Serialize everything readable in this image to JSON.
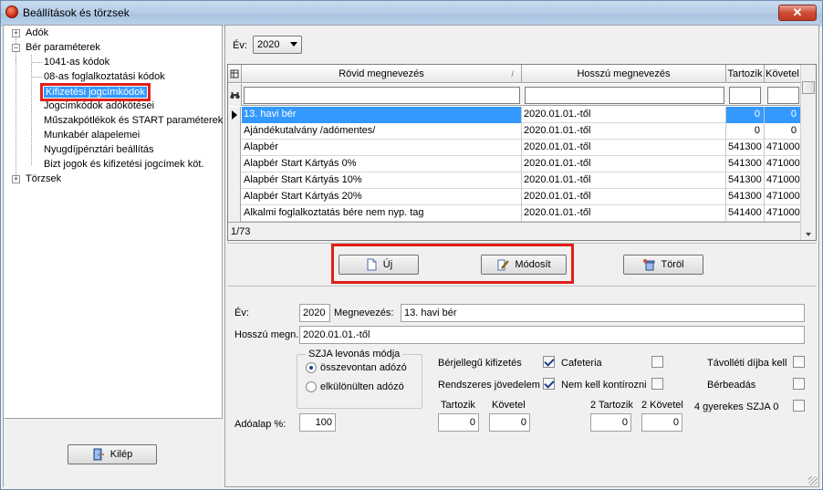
{
  "window": {
    "title": "Beállítások és törzsek",
    "close_label": "✕"
  },
  "tree": {
    "items": [
      {
        "label": "Adók",
        "level": 0,
        "expander": "+"
      },
      {
        "label": "Bér paraméterek",
        "level": 0,
        "expander": "−"
      },
      {
        "label": "1041-as kódok",
        "level": 1
      },
      {
        "label": "08-as foglalkoztatási kódok",
        "level": 1
      },
      {
        "label": "Kifizetési jogcímkódok",
        "level": 1,
        "selected": true
      },
      {
        "label": "Jogcímkódok adókötései",
        "level": 1
      },
      {
        "label": "Műszakpótlékok és START paraméterek",
        "level": 1
      },
      {
        "label": "Munkabér alapelemei",
        "level": 1
      },
      {
        "label": "Nyugdíjpénztári beállítás",
        "level": 1
      },
      {
        "label": "Bizt jogok és kifizetési jogcímek köt.",
        "level": 1
      },
      {
        "label": "Törzsek",
        "level": 0,
        "expander": "+"
      }
    ]
  },
  "exit_button": {
    "label": "Kilép"
  },
  "year_filter": {
    "label": "Év:",
    "value": "2020"
  },
  "grid": {
    "columns": [
      "Rövid megnevezés",
      "Hosszú megnevezés",
      "Tartozik",
      "Követel"
    ],
    "rows": [
      [
        "13. havi bér",
        "2020.01.01.-től",
        "0",
        "0"
      ],
      [
        "Ajándékutalvány /adómentes/",
        "2020.01.01.-től",
        "0",
        "0"
      ],
      [
        "Alapbér",
        "2020.01.01.-től",
        "541300",
        "471000"
      ],
      [
        "Alapbér Start Kártyás 0%",
        "2020.01.01.-től",
        "541300",
        "471000"
      ],
      [
        "Alapbér Start Kártyás 10%",
        "2020.01.01.-től",
        "541300",
        "471000"
      ],
      [
        "Alapbér Start Kártyás 20%",
        "2020.01.01.-től",
        "541300",
        "471000"
      ],
      [
        "Alkalmi foglalkoztatás bére nem nyp. tag",
        "2020.01.01.-től",
        "541400",
        "471000"
      ]
    ],
    "footer": "1/73"
  },
  "buttons": {
    "new_label": "Új",
    "modify_label": "Módosít",
    "delete_label": "Töröl"
  },
  "form": {
    "year_label": "Év:",
    "year_value": "2020",
    "name_label": "Megnevezés:",
    "name_value": "13. havi bér",
    "long_label": "Hosszú megn.:",
    "long_value": "2020.01.01.-től",
    "szja_group_label": "SZJA levonás módja",
    "radio_1": "összevontan adózó",
    "radio_2": "elkülönülten adózó",
    "berjellegu_label": "Bérjellegű kifizetés",
    "cafeteria_label": "Cafeteria",
    "tavolleti_label": "Távolléti díjba kell",
    "rendszeres_label": "Rendszeres jövedelem",
    "nemkell_label": "Nem kell kontírozni",
    "berbeadas_label": "Bérbeadás",
    "tartozik_label": "Tartozik",
    "tartozik_value": "0",
    "kovetel_label": "Követel",
    "kovetel_value": "0",
    "tartozik2_label": "2 Tartozik",
    "tartozik2_value": "0",
    "kovetel2_label": "2 Követel",
    "kovetel2_value": "0",
    "gyerekes_label": "4 gyerekes SZJA 0",
    "adoalap_label": "Adóalap %:",
    "adoalap_value": "100"
  }
}
